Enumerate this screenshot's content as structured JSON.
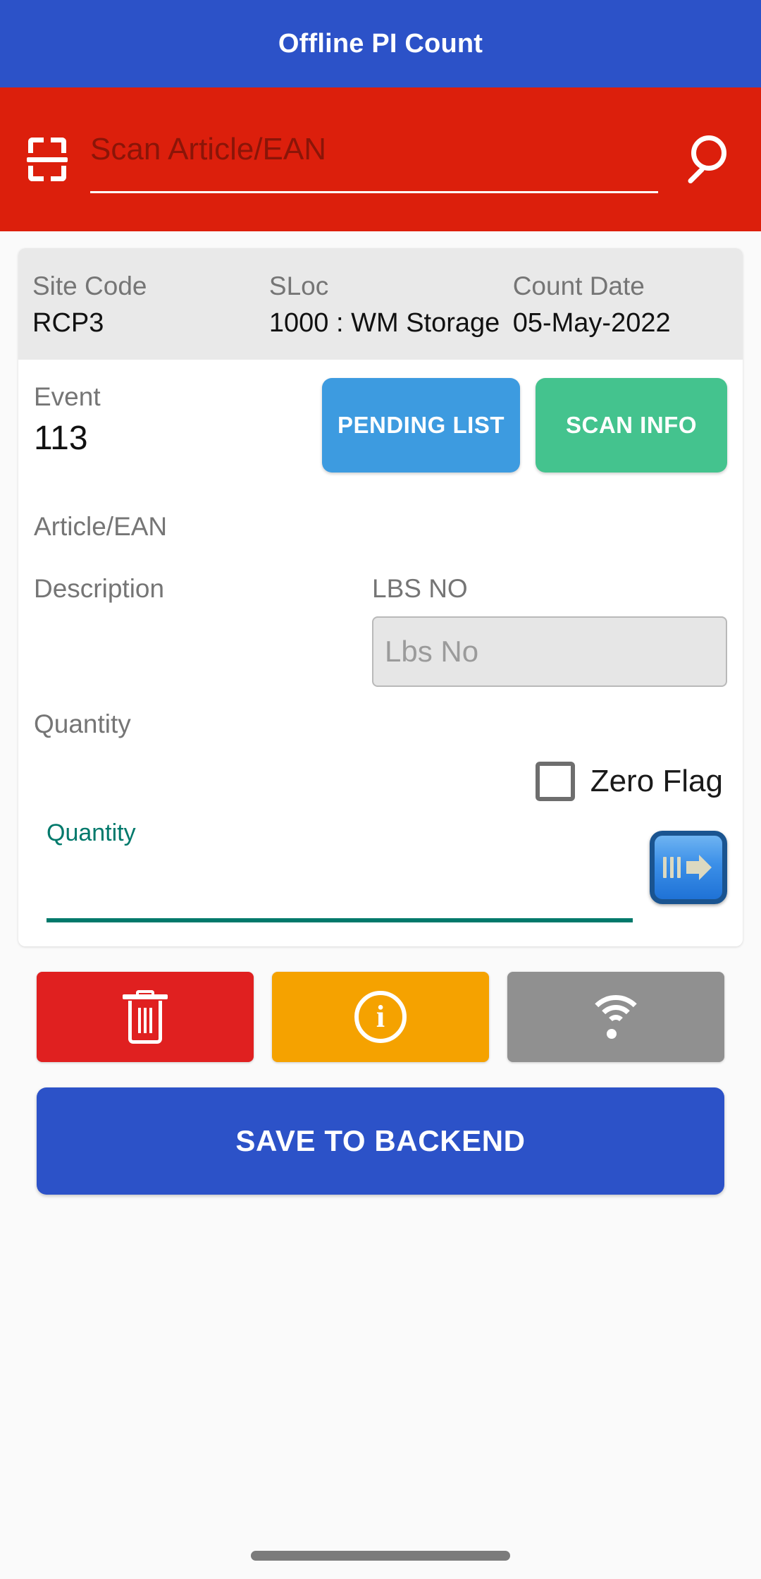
{
  "appbar": {
    "title": "Offline PI Count"
  },
  "search": {
    "scan_icon": "barcode-scan-icon",
    "placeholder": "Scan Article/EAN",
    "value": "",
    "search_icon": "search-icon"
  },
  "meta": {
    "site_code_label": "Site Code",
    "site_code_value": "RCP3",
    "sloc_label": "SLoc",
    "sloc_value": "1000 : WM Storage",
    "count_date_label": "Count Date",
    "count_date_value": "05-May-2022"
  },
  "event": {
    "label": "Event",
    "value": "113",
    "pending_list_label": "PENDING LIST",
    "scan_info_label": "SCAN INFO"
  },
  "form": {
    "article_ean_label": "Article/EAN",
    "description_label": "Description",
    "lbs_no_label": "LBS NO",
    "lbs_no_placeholder": "Lbs No",
    "lbs_no_value": "",
    "quantity_label": "Quantity",
    "zero_flag_label": "Zero Flag",
    "zero_flag_checked": false,
    "quantity_float_label": "Quantity",
    "quantity_value": "",
    "submit_icon": "arrow-right-icon"
  },
  "actions": {
    "delete_icon": "trash-icon",
    "info_icon": "info-circle-icon",
    "info_glyph": "i",
    "wifi_icon": "wifi-icon",
    "save_label": "SAVE TO BACKEND"
  },
  "colors": {
    "appbar_blue": "#2C52C8",
    "search_red": "#DC1F0C",
    "pending_blue": "#3D9BE0",
    "scan_green": "#44C38E",
    "delete_red": "#E02020",
    "info_orange": "#F5A200",
    "wifi_grey": "#909090",
    "quantity_teal": "#00796B"
  }
}
